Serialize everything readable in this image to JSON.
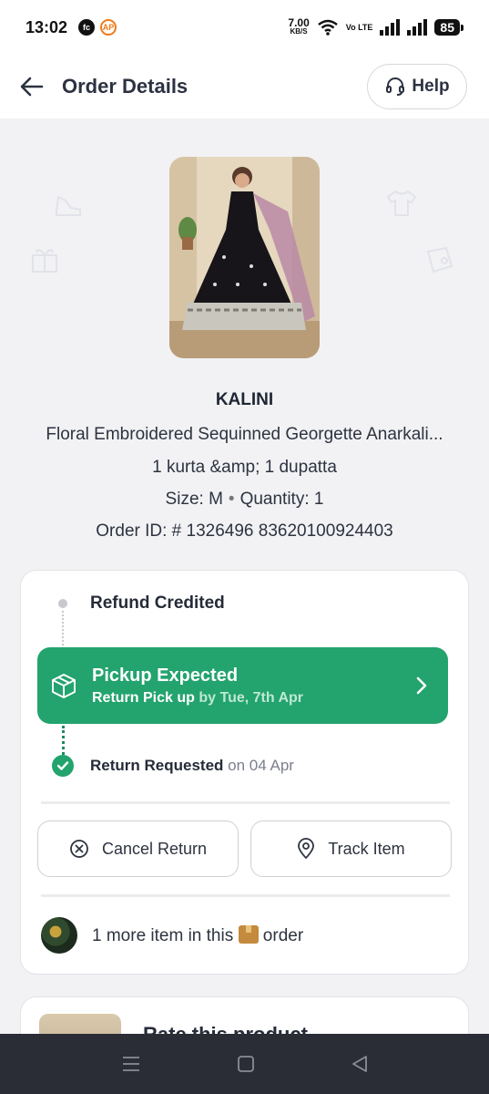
{
  "status_bar": {
    "time": "13:02",
    "notif_icons": [
      "fc",
      "AP"
    ],
    "speed_value": "7.00",
    "speed_unit": "KB/S",
    "network_label": "Vo LTE",
    "battery": "85"
  },
  "header": {
    "title": "Order Details",
    "help_label": "Help"
  },
  "product": {
    "brand": "KALINI",
    "name": "Floral Embroidered Sequinned Georgette Anarkali...",
    "contents": "1 kurta &amp; 1 dupatta",
    "size_text": "Size: M",
    "separator": "•",
    "quantity_text": "Quantity: 1",
    "order_id_text": "Order ID: # 1326496 83620100924403"
  },
  "tracking": {
    "refund_label": "Refund Credited",
    "pickup_title": "Pickup Expected",
    "pickup_sub": "Return Pick up",
    "pickup_date": "by Tue, 7th Apr",
    "requested_label": "Return Requested",
    "requested_date": "on 04 Apr",
    "cancel_label": "Cancel Return",
    "track_label": "Track Item",
    "more_prefix": "1 more item in this",
    "more_suffix": "order"
  },
  "rate": {
    "label": "Rate this product"
  },
  "colors": {
    "accent_green": "#23a36d",
    "text_dark": "#1f2633",
    "nav_bg": "#2a2d36"
  }
}
